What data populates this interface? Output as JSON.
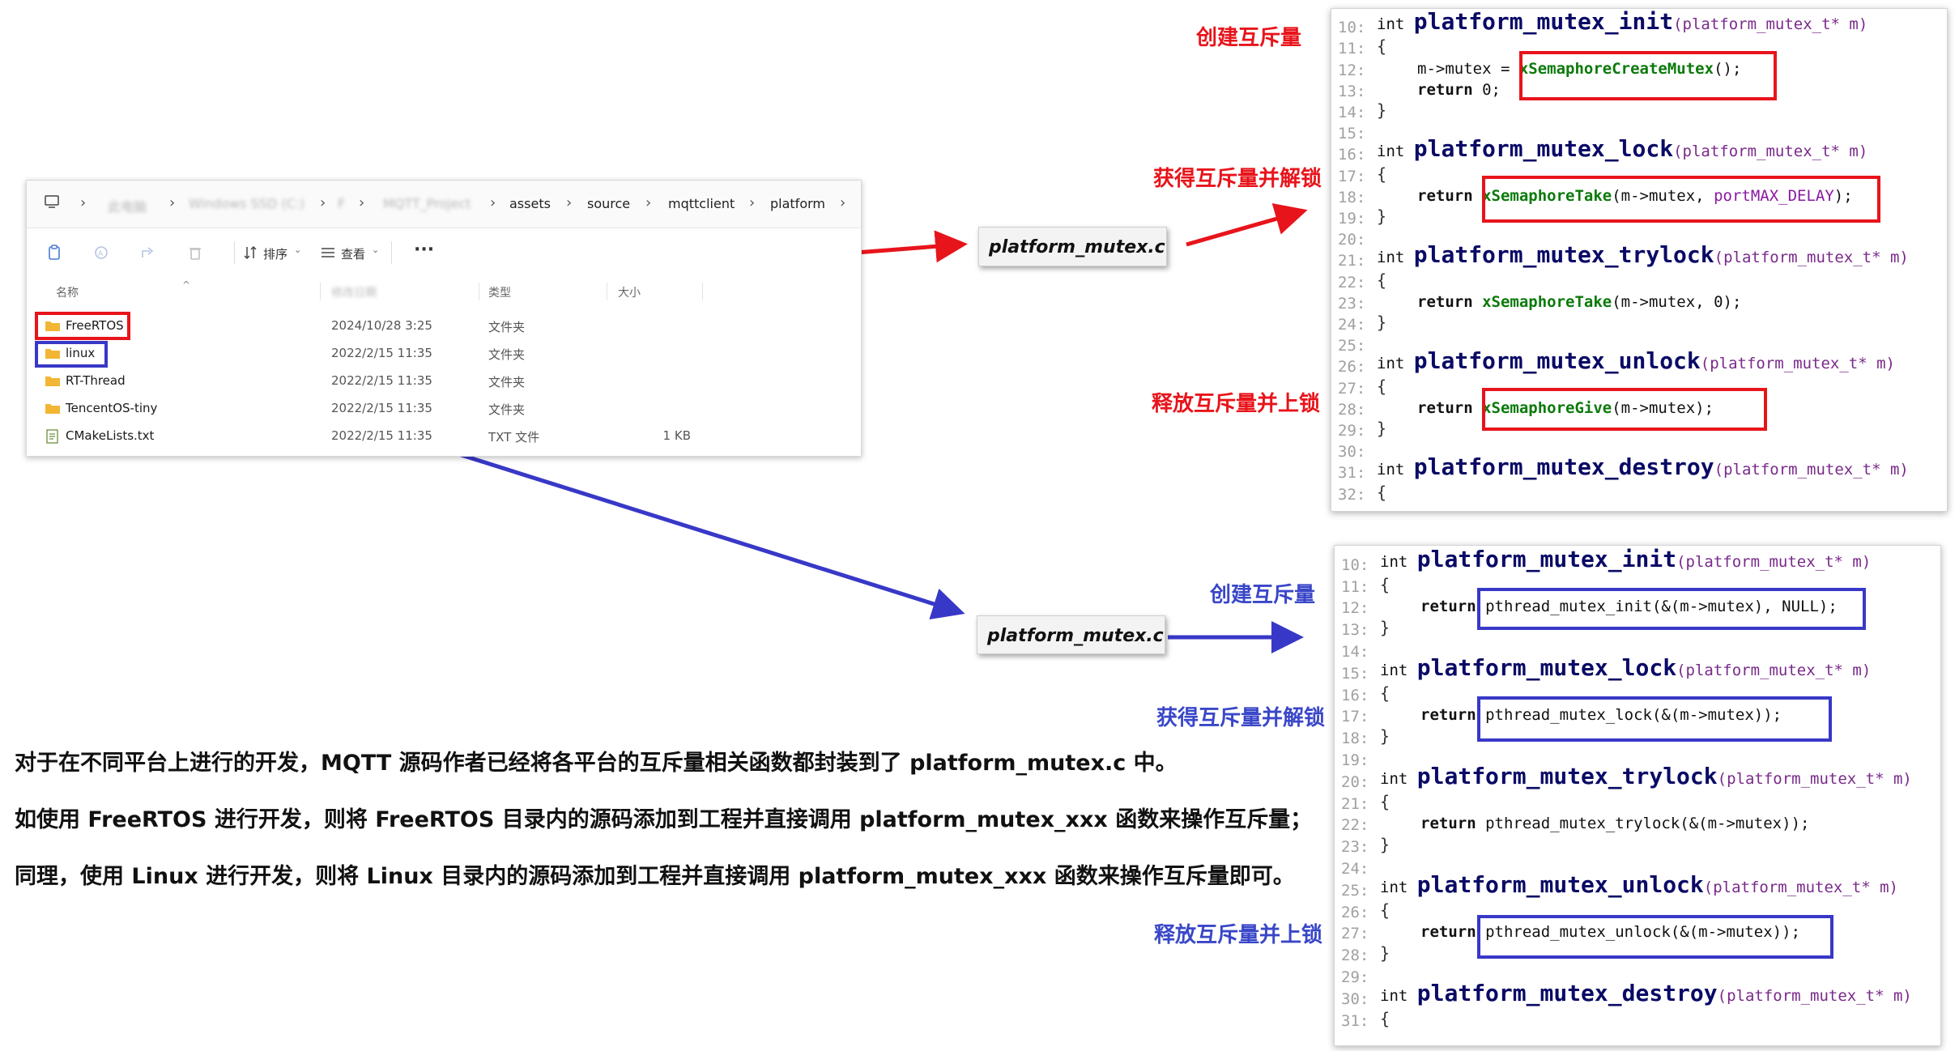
{
  "explorer": {
    "breadcrumb": [
      "此电脑",
      "Windows SSD (C:)",
      "F",
      "MQTT_Project",
      "assets",
      "source",
      "mqttclient",
      "platform"
    ],
    "toolbar": {
      "sort": "排序",
      "view": "查看",
      "more": "···"
    },
    "columns": {
      "name": "名称",
      "date": "修改日期",
      "type": "类型",
      "size": "大小"
    },
    "rows": [
      {
        "name": "FreeRTOS",
        "date": "2024/10/28 3:25",
        "type": "文件夹",
        "size": ""
      },
      {
        "name": "linux",
        "date": "2022/2/15 11:35",
        "type": "文件夹",
        "size": ""
      },
      {
        "name": "RT-Thread",
        "date": "2022/2/15 11:35",
        "type": "文件夹",
        "size": ""
      },
      {
        "name": "TencentOS-tiny",
        "date": "2022/2/15 11:35",
        "type": "文件夹",
        "size": ""
      },
      {
        "name": "CMakeLists.txt",
        "date": "2022/2/15 11:35",
        "type": "TXT 文件",
        "size": "1 KB"
      }
    ]
  },
  "file_labels": {
    "freertos": "platform_mutex.c",
    "linux": "platform_mutex.c"
  },
  "freertos_code": {
    "captions": {
      "create": "创建互斥量",
      "lock": "获得互斥量并解锁",
      "unlock": "释放互斥量并上锁"
    },
    "lines": [
      {
        "n": "10:",
        "kw": "int",
        "fn": "platform_mutex_init",
        "param": "(platform_mutex_t* m)"
      },
      {
        "n": "11:",
        "text": "{"
      },
      {
        "n": "12:",
        "pre": "m->mutex = ",
        "call": "xSemaphoreCreateMutex",
        "post": "();"
      },
      {
        "n": "13:",
        "ret": "return",
        "post": " 0;"
      },
      {
        "n": "14:",
        "text": "}"
      },
      {
        "n": "15:",
        "text": ""
      },
      {
        "n": "16:",
        "kw": "int",
        "fn": "platform_mutex_lock",
        "param": "(platform_mutex_t* m)"
      },
      {
        "n": "17:",
        "text": "{"
      },
      {
        "n": "18:",
        "ret": "return",
        "call": "xSemaphoreTake",
        "args": "(m->mutex, ",
        "arg2": "portMAX_DELAY",
        "post": ");"
      },
      {
        "n": "19:",
        "text": "}"
      },
      {
        "n": "20:",
        "text": ""
      },
      {
        "n": "21:",
        "kw": "int",
        "fn": "platform_mutex_trylock",
        "param": "(platform_mutex_t* m)"
      },
      {
        "n": "22:",
        "text": "{"
      },
      {
        "n": "23:",
        "ret": "return",
        "call": "xSemaphoreTake",
        "args": "(m->mutex, 0);"
      },
      {
        "n": "24:",
        "text": "}"
      },
      {
        "n": "25:",
        "text": ""
      },
      {
        "n": "26:",
        "kw": "int",
        "fn": "platform_mutex_unlock",
        "param": "(platform_mutex_t* m)"
      },
      {
        "n": "27:",
        "text": "{"
      },
      {
        "n": "28:",
        "ret": "return",
        "call": "xSemaphoreGive",
        "args": "(m->mutex);"
      },
      {
        "n": "29:",
        "text": "}"
      },
      {
        "n": "30:",
        "text": ""
      },
      {
        "n": "31:",
        "kw": "int",
        "fn": "platform_mutex_destroy",
        "param": "(platform_mutex_t* m)"
      },
      {
        "n": "32:",
        "text": "{"
      }
    ]
  },
  "linux_code": {
    "captions": {
      "create": "创建互斥量",
      "lock": "获得互斥量并解锁",
      "unlock": "释放互斥量并上锁"
    },
    "lines": [
      {
        "n": "10:",
        "kw": "int",
        "fn": "platform_mutex_init",
        "param": "(platform_mutex_t* m)"
      },
      {
        "n": "11:",
        "text": "{"
      },
      {
        "n": "12:",
        "ret": "return",
        "plain": "pthread_mutex_init(&(m->mutex), NULL);"
      },
      {
        "n": "13:",
        "text": "}"
      },
      {
        "n": "14:",
        "text": ""
      },
      {
        "n": "15:",
        "kw": "int",
        "fn": "platform_mutex_lock",
        "param": "(platform_mutex_t* m)"
      },
      {
        "n": "16:",
        "text": "{"
      },
      {
        "n": "17:",
        "ret": "return",
        "plain": "pthread_mutex_lock(&(m->mutex));"
      },
      {
        "n": "18:",
        "text": "}"
      },
      {
        "n": "19:",
        "text": ""
      },
      {
        "n": "20:",
        "kw": "int",
        "fn": "platform_mutex_trylock",
        "param": "(platform_mutex_t* m)"
      },
      {
        "n": "21:",
        "text": "{"
      },
      {
        "n": "22:",
        "ret": "return",
        "plain": "pthread_mutex_trylock(&(m->mutex));"
      },
      {
        "n": "23:",
        "text": "}"
      },
      {
        "n": "24:",
        "text": ""
      },
      {
        "n": "25:",
        "kw": "int",
        "fn": "platform_mutex_unlock",
        "param": "(platform_mutex_t* m)"
      },
      {
        "n": "26:",
        "text": "{"
      },
      {
        "n": "27:",
        "ret": "return",
        "plain": "pthread_mutex_unlock(&(m->mutex));"
      },
      {
        "n": "28:",
        "text": "}"
      },
      {
        "n": "29:",
        "text": ""
      },
      {
        "n": "30:",
        "kw": "int",
        "fn": "platform_mutex_destroy",
        "param": "(platform_mutex_t* m)"
      },
      {
        "n": "31:",
        "text": "{"
      }
    ]
  },
  "description": [
    "对于在不同平台上进行的开发，MQTT 源码作者已经将各平台的互斥量相关函数都封装到了 platform_mutex.c 中。",
    "如使用 FreeRTOS 进行开发，则将 FreeRTOS 目录内的源码添加到工程并直接调用 platform_mutex_xxx 函数来操作互斥量；",
    "同理，使用 Linux 进行开发，则将 Linux 目录内的源码添加到工程并直接调用 platform_mutex_xxx 函数来操作互斥量即可。"
  ],
  "colors": {
    "freertos_accent": "#e8141b",
    "linux_accent": "#3838c8",
    "folder": "#f2b634"
  }
}
